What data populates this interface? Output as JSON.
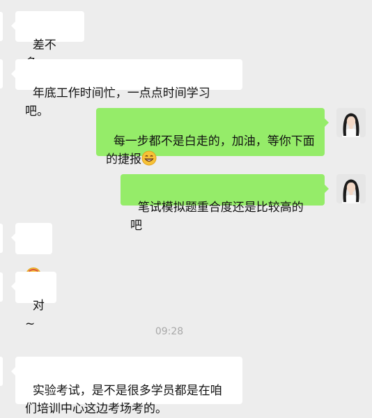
{
  "messages": [
    {
      "side": "left",
      "text": "差不多。"
    },
    {
      "side": "left",
      "text": "年底工作时间忙，一点点时间学习吧。"
    },
    {
      "side": "right",
      "text": "每一步都不是白走的，加油，等你下面的捷报",
      "emoji": "grin-face-emoji"
    },
    {
      "side": "right",
      "text": "笔试模拟题重合度还是比较高的吧"
    },
    {
      "side": "left",
      "emoji": "shush-face-emoji"
    },
    {
      "side": "left",
      "text": "对~"
    },
    {
      "side": "left",
      "text": "实验考试，是不是很多学员都是在咱们培训中心这边考场考的。"
    }
  ],
  "timestamp": "09:28",
  "colors": {
    "background": "#ededed",
    "sent_bubble": "#95ec69",
    "received_bubble": "#ffffff",
    "timestamp": "#a8a8a8"
  }
}
